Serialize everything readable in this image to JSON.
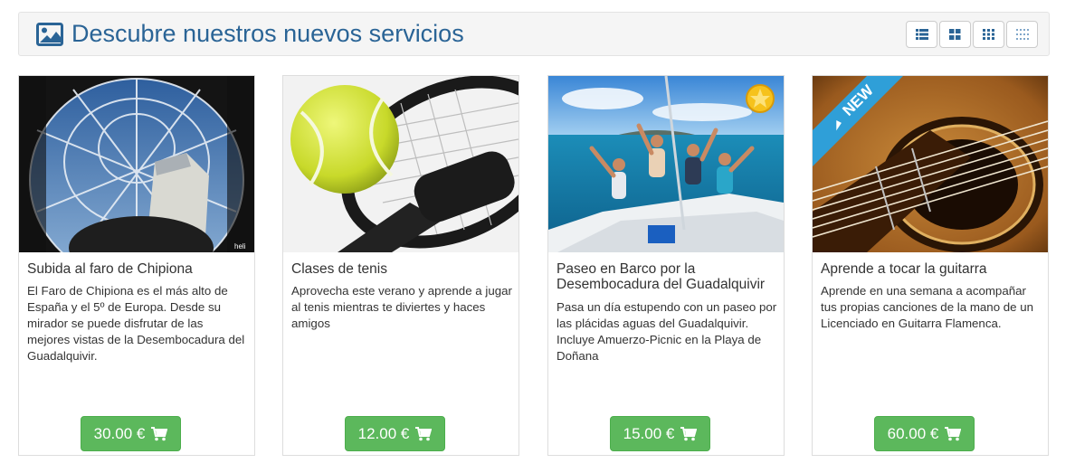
{
  "header": {
    "title": "Descubre nuestros nuevos servicios",
    "title_icon": "picture-icon",
    "view_buttons": [
      {
        "icon": "list-view-icon"
      },
      {
        "icon": "grid-large-icon"
      },
      {
        "icon": "grid-medium-icon"
      },
      {
        "icon": "grid-small-icon"
      }
    ]
  },
  "colors": {
    "title": "#2a6496",
    "button": "#5cb85c",
    "new_ribbon": "#2f9fd8"
  },
  "products": [
    {
      "title": "Subida al faro de Chipiona",
      "description": "El Faro de Chipiona es el más alto de España y el 5º de Europa. Desde su mirador se puede disfrutar de las mejores vistas de la Desembocadura del Guadalquivir.",
      "price": "30.00 €",
      "image_watermark": "heli"
    },
    {
      "title": "Clases de tenis",
      "description": "Aprovecha este verano y aprende a jugar al tenis mientras te diviertes y haces amigos",
      "price": "12.00 €"
    },
    {
      "title": "Paseo en Barco por la Desembocadura del Guadalquivir",
      "description": "Pasa un día estupendo con un paseo por las plácidas aguas del Guadalquivir. Incluye Amuerzo-Picnic en la Playa de Doñana",
      "price": "15.00 €",
      "badge_icon": "star-icon"
    },
    {
      "title": "Aprende a tocar la guitarra",
      "description": "Aprende en una semana a acompañar tus propias canciones de la mano de un Licenciado en Guitarra Flamenca.",
      "price": "60.00 €",
      "ribbon": "NEW"
    }
  ]
}
